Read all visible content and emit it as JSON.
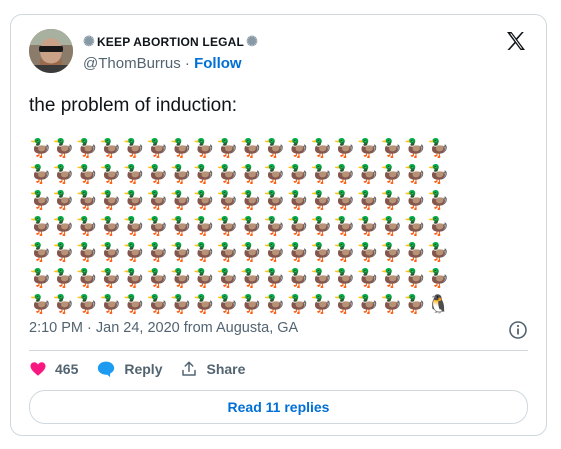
{
  "author": {
    "display_name": "KEEP ABORTION LEGAL",
    "handle": "@ThomBurrus",
    "follow_label": "Follow"
  },
  "tweet": {
    "text": "the problem of induction:",
    "emoji_rows": [
      "🦆🦆🦆🦆🦆🦆🦆🦆🦆🦆🦆🦆🦆🦆🦆🦆🦆🦆",
      "🦆🦆🦆🦆🦆🦆🦆🦆🦆🦆🦆🦆🦆🦆🦆🦆🦆🦆",
      "🦆🦆🦆🦆🦆🦆🦆🦆🦆🦆🦆🦆🦆🦆🦆🦆🦆🦆",
      "🦆🦆🦆🦆🦆🦆🦆🦆🦆🦆🦆🦆🦆🦆🦆🦆🦆🦆",
      "🦆🦆🦆🦆🦆🦆🦆🦆🦆🦆🦆🦆🦆🦆🦆🦆🦆🦆",
      "🦆🦆🦆🦆🦆🦆🦆🦆🦆🦆🦆🦆🦆🦆🦆🦆🦆🦆",
      "🦆🦆🦆🦆🦆🦆🦆🦆🦆🦆🦆🦆🦆🦆🦆🦆🦆🐧"
    ],
    "meta": "2:10 PM · Jan 24, 2020 from Augusta, GA"
  },
  "actions": {
    "like_count": "465",
    "reply_label": "Reply",
    "share_label": "Share",
    "read_replies_label": "Read 11 replies"
  },
  "colors": {
    "accent": "#006fd6",
    "like": "#f91880",
    "reply": "#1d9bf0",
    "border": "#cfd9de",
    "muted": "#536471"
  }
}
